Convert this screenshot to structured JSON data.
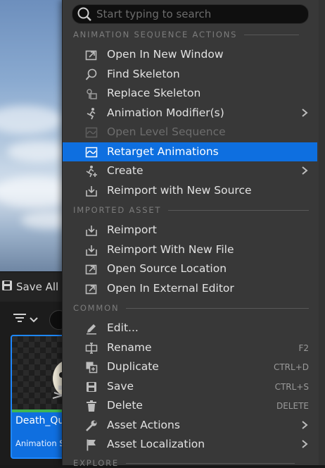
{
  "search": {
    "placeholder": "Start typing to search"
  },
  "toolbar": {
    "save_all_label": "Save All"
  },
  "asset": {
    "name": "Death_QuS",
    "type": "Animation S."
  },
  "sections": {
    "animation_sequence": "ANIMATION SEQUENCE ACTIONS",
    "imported_asset": "IMPORTED ASSET",
    "common": "COMMON",
    "explore": "EXPLORE"
  },
  "items": {
    "open_new_window": "Open In New Window",
    "find_skeleton": "Find Skeleton",
    "replace_skeleton": "Replace Skeleton",
    "animation_modifiers": "Animation Modifier(s)",
    "open_level_sequence": "Open Level Sequence",
    "retarget_animations": "Retarget Animations",
    "create": "Create",
    "reimport_new_source": "Reimport with New Source",
    "reimport": "Reimport",
    "reimport_new_file": "Reimport With New File",
    "open_source_location": "Open Source Location",
    "open_external_editor": "Open In External Editor",
    "edit": "Edit...",
    "rename": "Rename",
    "rename_shortcut": "F2",
    "duplicate": "Duplicate",
    "duplicate_shortcut": "CTRL+D",
    "save": "Save",
    "save_shortcut": "CTRL+S",
    "delete": "Delete",
    "delete_shortcut": "DELETE",
    "asset_actions": "Asset Actions",
    "asset_localization": "Asset Localization"
  },
  "colors": {
    "accent": "#0e6fe0",
    "menu_bg": "#383838",
    "disabled": "#6d6d6d"
  }
}
